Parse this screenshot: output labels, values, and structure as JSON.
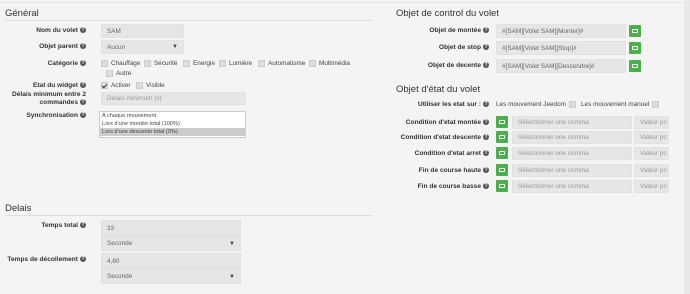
{
  "general": {
    "title": "Général",
    "name_label": "Nom du volet",
    "name_value": "SAM",
    "parent_label": "Objet parent",
    "parent_value": "Aucun",
    "category_label": "Catégorie",
    "categories": [
      {
        "label": "Chauffage",
        "checked": false
      },
      {
        "label": "Sécurité",
        "checked": false
      },
      {
        "label": "Energie",
        "checked": false
      },
      {
        "label": "Lumière",
        "checked": false
      },
      {
        "label": "Automatisme",
        "checked": false
      },
      {
        "label": "Multimédia",
        "checked": false
      },
      {
        "label": "Autre",
        "checked": false
      }
    ],
    "state_label": "Etat du widget",
    "activate_label": "Activer",
    "visible_label": "Visible",
    "delay_label_line1": "Délais minimum entre 2",
    "delay_label_line2": "commandes",
    "delay_placeholder": "Délais minimum (s)",
    "sync_label": "Synchronisation",
    "sync_options": [
      "A chaque mouvement",
      "Lors d'une montée total (100%)",
      "Lors d'une descente total (0%)"
    ]
  },
  "delays": {
    "title": "Delais",
    "total_label": "Temps total",
    "total_value": "33",
    "total_unit": "Seconde",
    "release_label": "Temps de décollement",
    "release_value": "4,60",
    "release_unit": "Seconde"
  },
  "control": {
    "title": "Objet de control du volet",
    "rows": [
      {
        "label": "Objet de montée",
        "value": "#[SAM][Volet SAM][Monter]#"
      },
      {
        "label": "Objet de stop",
        "value": "#[SAM][Volet SAM][Stop]#"
      },
      {
        "label": "Objet de decente",
        "value": "#[SAM][Volet SAM][Descendre]#"
      }
    ]
  },
  "state": {
    "title": "Objet d'état du volet",
    "use_label": "Utiliser les etat sur :",
    "jeedom_label": "Les mouvement Jeedom",
    "manual_label": "Les mouvement manuel",
    "select_placeholder": "Sélectionner une comma",
    "value_placeholder": "Valeur pc",
    "rows": [
      {
        "label": "Condition d'etat montée"
      },
      {
        "label": "Condition d'etat descente"
      },
      {
        "label": "Condition d'etat arret"
      },
      {
        "label": "Fin de course haute"
      },
      {
        "label": "Fin de course basse"
      }
    ]
  }
}
